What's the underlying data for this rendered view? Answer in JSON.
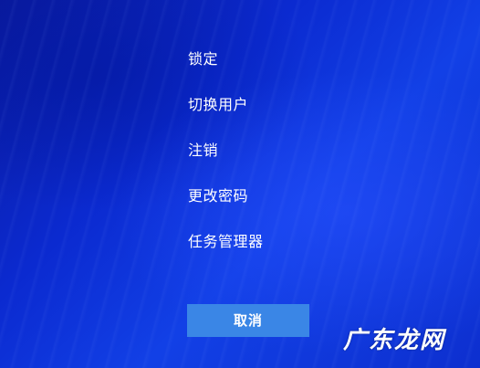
{
  "menu": {
    "items": [
      {
        "label": "锁定"
      },
      {
        "label": "切换用户"
      },
      {
        "label": "注销"
      },
      {
        "label": "更改密码"
      },
      {
        "label": "任务管理器"
      }
    ]
  },
  "cancel_button": {
    "label": "取消"
  },
  "watermark": {
    "text": "广东龙网"
  },
  "colors": {
    "background": "#0b2ad0",
    "button": "#3a86e6",
    "text": "#ffffff"
  }
}
